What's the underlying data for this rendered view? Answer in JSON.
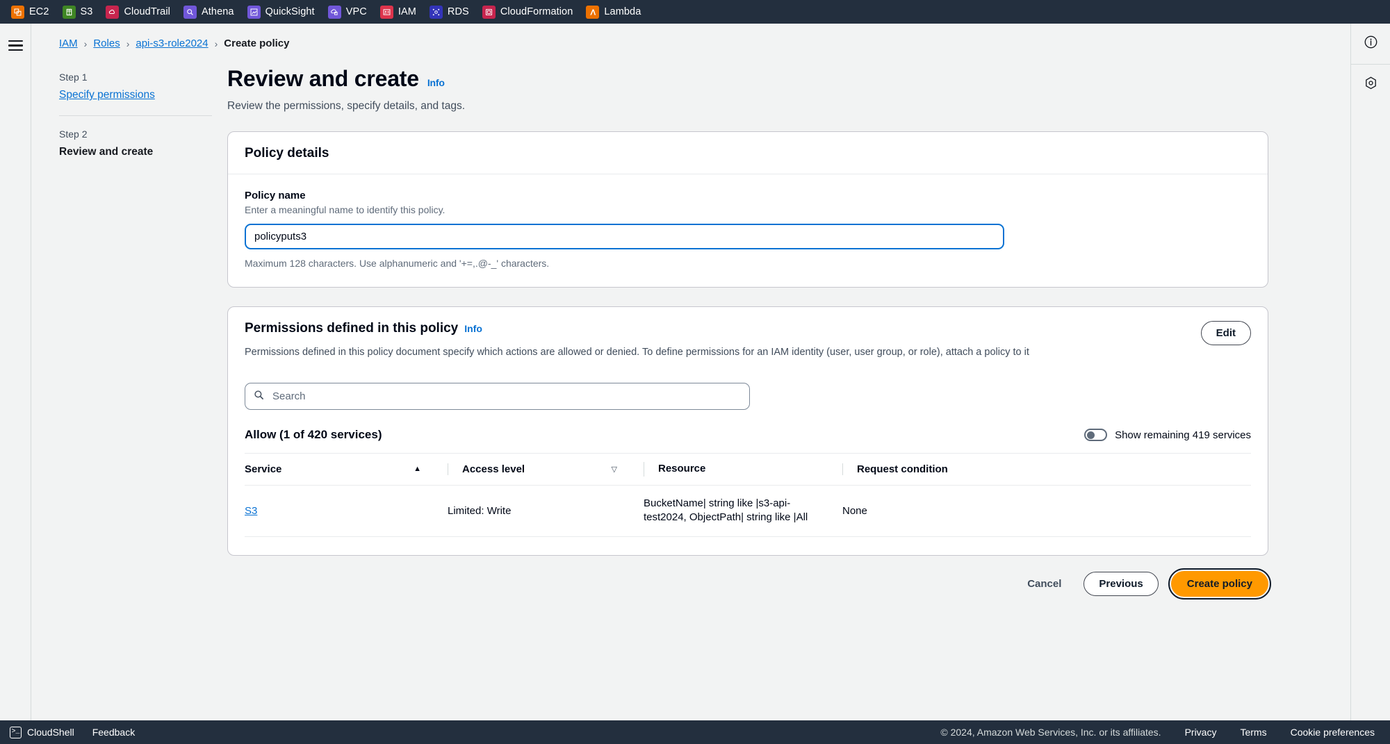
{
  "topbar": {
    "services": [
      {
        "label": "EC2",
        "icon": "ec2-icon",
        "color": "#ed7100"
      },
      {
        "label": "S3",
        "icon": "s3-icon",
        "color": "#3f8624"
      },
      {
        "label": "CloudTrail",
        "icon": "cloudtrail-icon",
        "color": "#c7254e"
      },
      {
        "label": "Athena",
        "icon": "athena-icon",
        "color": "#7157d9"
      },
      {
        "label": "QuickSight",
        "icon": "quicksight-icon",
        "color": "#7157d9"
      },
      {
        "label": "VPC",
        "icon": "vpc-icon",
        "color": "#7157d9"
      },
      {
        "label": "IAM",
        "icon": "iam-icon",
        "color": "#dd344c"
      },
      {
        "label": "RDS",
        "icon": "rds-icon",
        "color": "#3334b9"
      },
      {
        "label": "CloudFormation",
        "icon": "cloudformation-icon",
        "color": "#c7254e"
      },
      {
        "label": "Lambda",
        "icon": "lambda-icon",
        "color": "#ed7100"
      }
    ]
  },
  "breadcrumb": {
    "items": [
      {
        "label": "IAM",
        "current": false
      },
      {
        "label": "Roles",
        "current": false
      },
      {
        "label": "api-s3-role2024",
        "current": false
      },
      {
        "label": "Create policy",
        "current": true
      }
    ],
    "separator": "›"
  },
  "wizard": {
    "steps": [
      {
        "number": "Step 1",
        "label": "Specify permissions",
        "current": false
      },
      {
        "number": "Step 2",
        "label": "Review and create",
        "current": true
      }
    ]
  },
  "page": {
    "title": "Review and create",
    "info_label": "Info",
    "subtitle": "Review the permissions, specify details, and tags."
  },
  "policy_details": {
    "title": "Policy details",
    "name_label": "Policy name",
    "name_hint": "Enter a meaningful name to identify this policy.",
    "name_value": "policyputs3",
    "name_placeholder": "",
    "name_constraint": "Maximum 128 characters. Use alphanumeric and '+=,.@-_' characters."
  },
  "permissions": {
    "title": "Permissions defined in this policy",
    "info_label": "Info",
    "description": "Permissions defined in this policy document specify which actions are allowed or denied. To define permissions for an IAM identity (user, user group, or role), attach a policy to it",
    "edit_label": "Edit",
    "search_placeholder": "Search",
    "search_value": "",
    "allow_summary": "Allow (1 of 420 services)",
    "toggle_label": "Show remaining 419 services",
    "toggle_on": false,
    "columns": [
      {
        "label": "Service",
        "sort": "asc"
      },
      {
        "label": "Access level",
        "sort": "desc"
      },
      {
        "label": "Resource",
        "sort": "none"
      },
      {
        "label": "Request condition",
        "sort": "none"
      }
    ],
    "rows": [
      {
        "service": "S3",
        "access_level": "Limited: Write",
        "resource": "BucketName| string like |s3-api-test2024, ObjectPath| string like |All",
        "request_condition": "None"
      }
    ]
  },
  "actions": {
    "cancel_label": "Cancel",
    "previous_label": "Previous",
    "create_label": "Create policy",
    "accent_color": "#ff9900"
  },
  "bottombar": {
    "cloudshell_label": "CloudShell",
    "feedback_label": "Feedback",
    "copyright": "© 2024, Amazon Web Services, Inc. or its affiliates.",
    "privacy_label": "Privacy",
    "terms_label": "Terms",
    "cookie_label": "Cookie preferences"
  }
}
